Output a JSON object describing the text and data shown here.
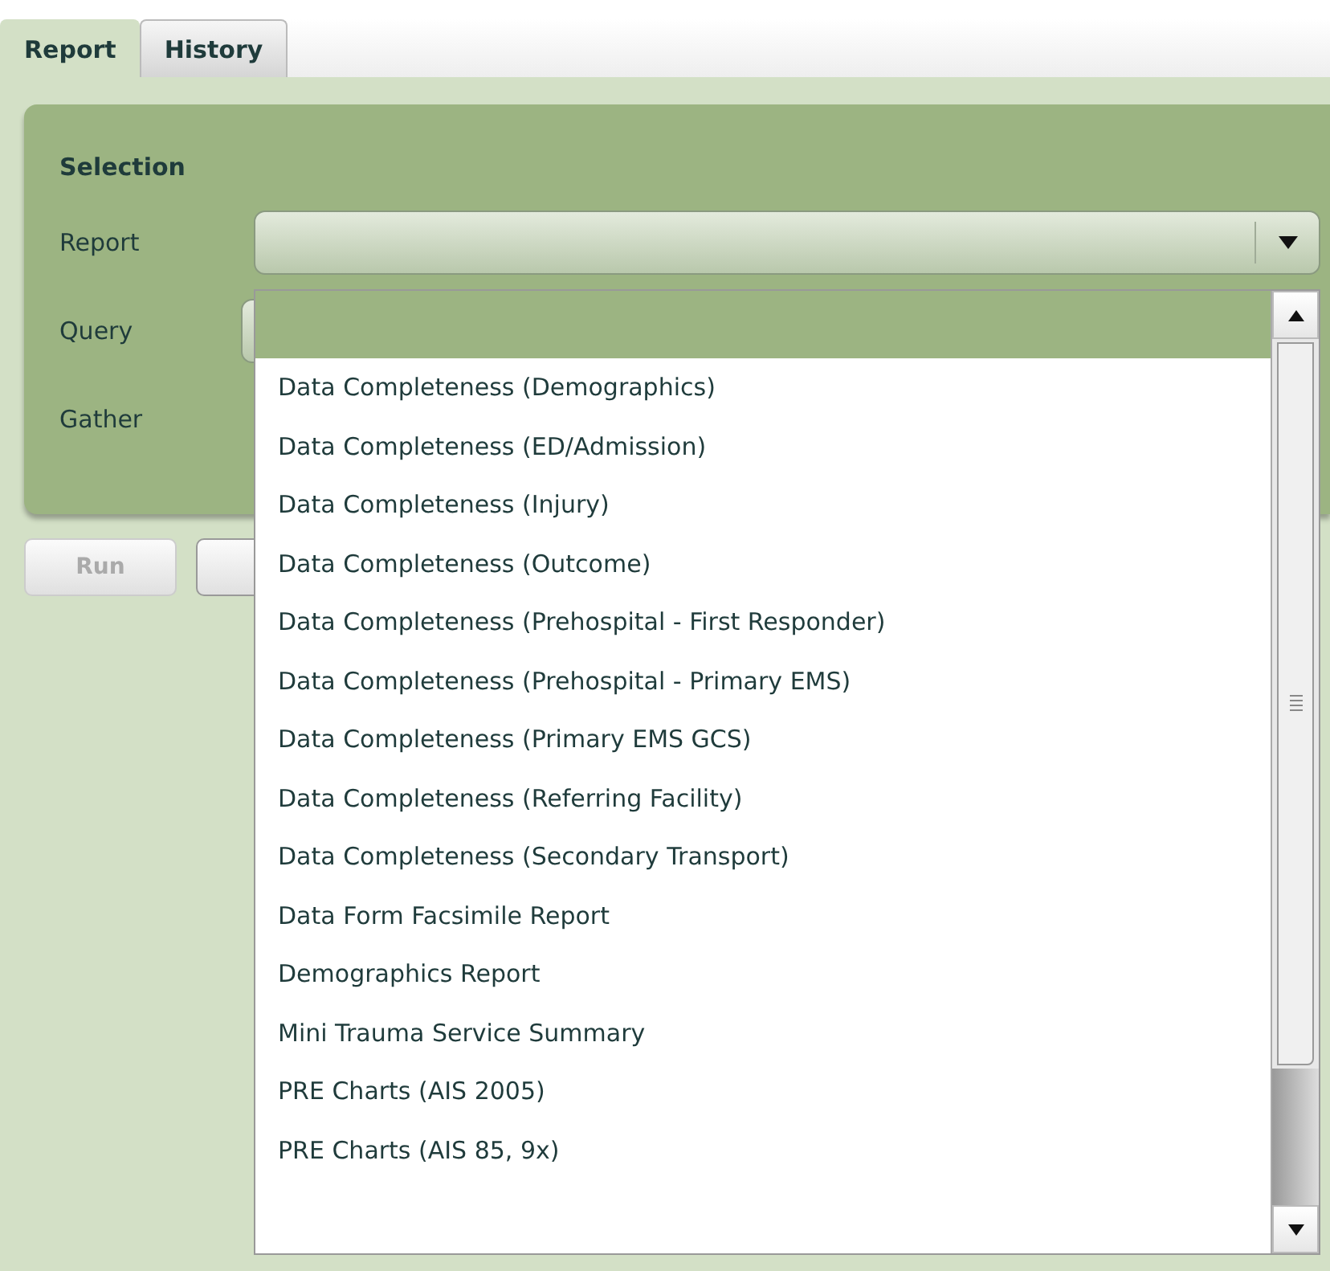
{
  "tabs": [
    {
      "label": "Report",
      "selected": true
    },
    {
      "label": "History",
      "selected": false
    }
  ],
  "selection": {
    "heading": "Selection",
    "fields": [
      {
        "label": "Report",
        "kind": "select"
      },
      {
        "label": "Query",
        "kind": "combo"
      },
      {
        "label": "Gather",
        "kind": "hidden"
      }
    ]
  },
  "buttons": [
    {
      "label": "Run",
      "disabled": true
    },
    {
      "disabled": false
    }
  ],
  "dropdown": {
    "items": [
      {
        "selected": true
      },
      {
        "label": "Data Completeness (Demographics)",
        "selected": false
      },
      {
        "label": "Data Completeness (ED/Admission)",
        "selected": false
      },
      {
        "label": "Data Completeness (Injury)",
        "selected": false
      },
      {
        "label": "Data Completeness (Outcome)",
        "selected": false
      },
      {
        "label": "Data Completeness (Prehospital - First Responder)",
        "selected": false
      },
      {
        "label": "Data Completeness (Prehospital - Primary EMS)",
        "selected": false
      },
      {
        "label": "Data Completeness (Primary EMS GCS)",
        "selected": false
      },
      {
        "label": "Data Completeness (Referring Facility)",
        "selected": false
      },
      {
        "label": "Data Completeness (Secondary Transport)",
        "selected": false
      },
      {
        "label": "Data Form Facsimile Report",
        "selected": false
      },
      {
        "label": "Demographics Report",
        "selected": false
      },
      {
        "label": "Mini Trauma Service Summary",
        "selected": false
      },
      {
        "label": "PRE Charts (AIS 2005)",
        "selected": false
      },
      {
        "label": "PRE Charts (AIS 85, 9x)",
        "selected": false
      }
    ]
  }
}
